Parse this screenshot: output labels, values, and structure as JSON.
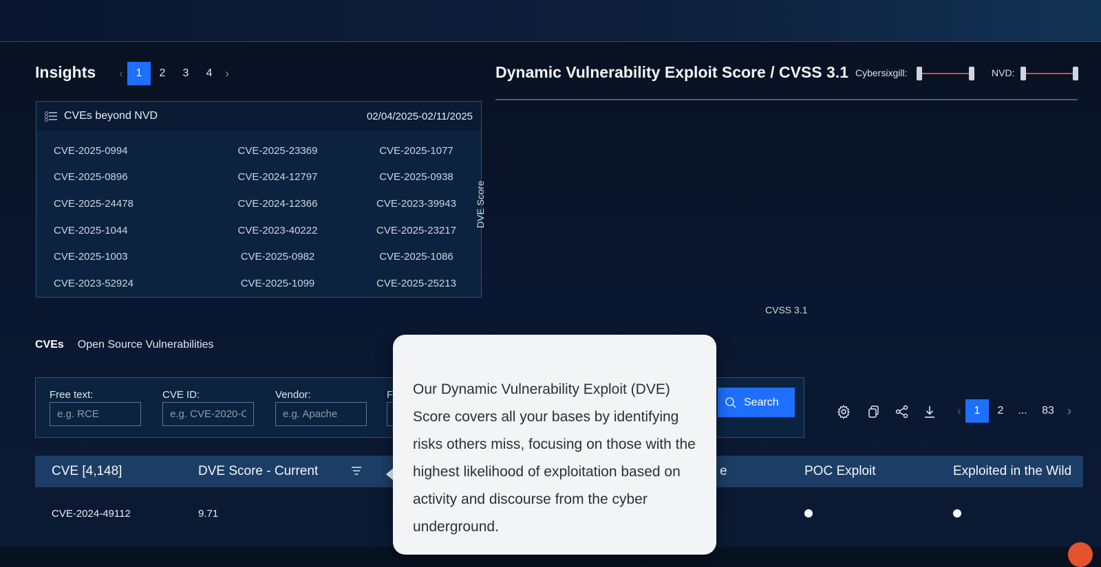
{
  "insights": {
    "title": "Insights",
    "pages": [
      "1",
      "2",
      "3",
      "4"
    ],
    "active_page": "1"
  },
  "cve_card": {
    "title": "CVEs beyond NVD",
    "date_range": "02/04/2025-02/11/2025",
    "rows": [
      [
        "CVE-2025-0994",
        "CVE-2025-23369",
        "CVE-2025-1077"
      ],
      [
        "CVE-2025-0896",
        "CVE-2024-12797",
        "CVE-2025-0938"
      ],
      [
        "CVE-2025-24478",
        "CVE-2024-12366",
        "CVE-2023-39943"
      ],
      [
        "CVE-2025-1044",
        "CVE-2023-40222",
        "CVE-2025-23217"
      ],
      [
        "CVE-2025-1003",
        "CVE-2025-0982",
        "CVE-2025-1086"
      ],
      [
        "CVE-2023-52924",
        "CVE-2025-1099",
        "CVE-2025-25213"
      ]
    ]
  },
  "chart": {
    "title": "Dynamic Vulnerability Exploit Score / CVSS 3.1",
    "legend_cybersixgill": "Cybersixgill:",
    "legend_nvd": "NVD:",
    "slider_color": "#d84a4a",
    "y_label": "DVE Score",
    "x_label": "CVSS 3.1"
  },
  "tabs": {
    "active": "CVEs",
    "other": "Open Source Vulnerabilities"
  },
  "filters": {
    "free_text_label": "Free text:",
    "free_text_placeholder": "e.g. RCE",
    "cve_id_label": "CVE ID:",
    "cve_id_placeholder": "e.g. CVE-2020-C",
    "vendor_label": "Vendor:",
    "vendor_placeholder": "e.g. Apache",
    "partial_label": "F",
    "search_label": "Search"
  },
  "toolbar": {
    "icons": [
      "gear-icon",
      "copy-icon",
      "share-icon",
      "download-icon"
    ]
  },
  "pager": {
    "page1": "1",
    "page2": "2",
    "ellipsis": "...",
    "last": "83"
  },
  "table": {
    "headers": {
      "cve": "CVE [4,148]",
      "dve": "DVE Score - Current",
      "partial": "e",
      "poc": "POC Exploit",
      "wild": "Exploited in the Wild"
    },
    "rows": [
      {
        "cve": "CVE-2024-49112",
        "dve": "9.71",
        "poc": true,
        "wild": true
      }
    ]
  },
  "tooltip": {
    "text": "Our Dynamic Vulnerability Exploit (DVE) Score covers all your bases by identifying risks others miss, focusing on those with the highest likelihood of exploitation based on activity and discourse from the cyber underground."
  },
  "colors": {
    "accent": "#1f6fff",
    "background": "#0a1730",
    "table_header": "#1c3e66"
  }
}
